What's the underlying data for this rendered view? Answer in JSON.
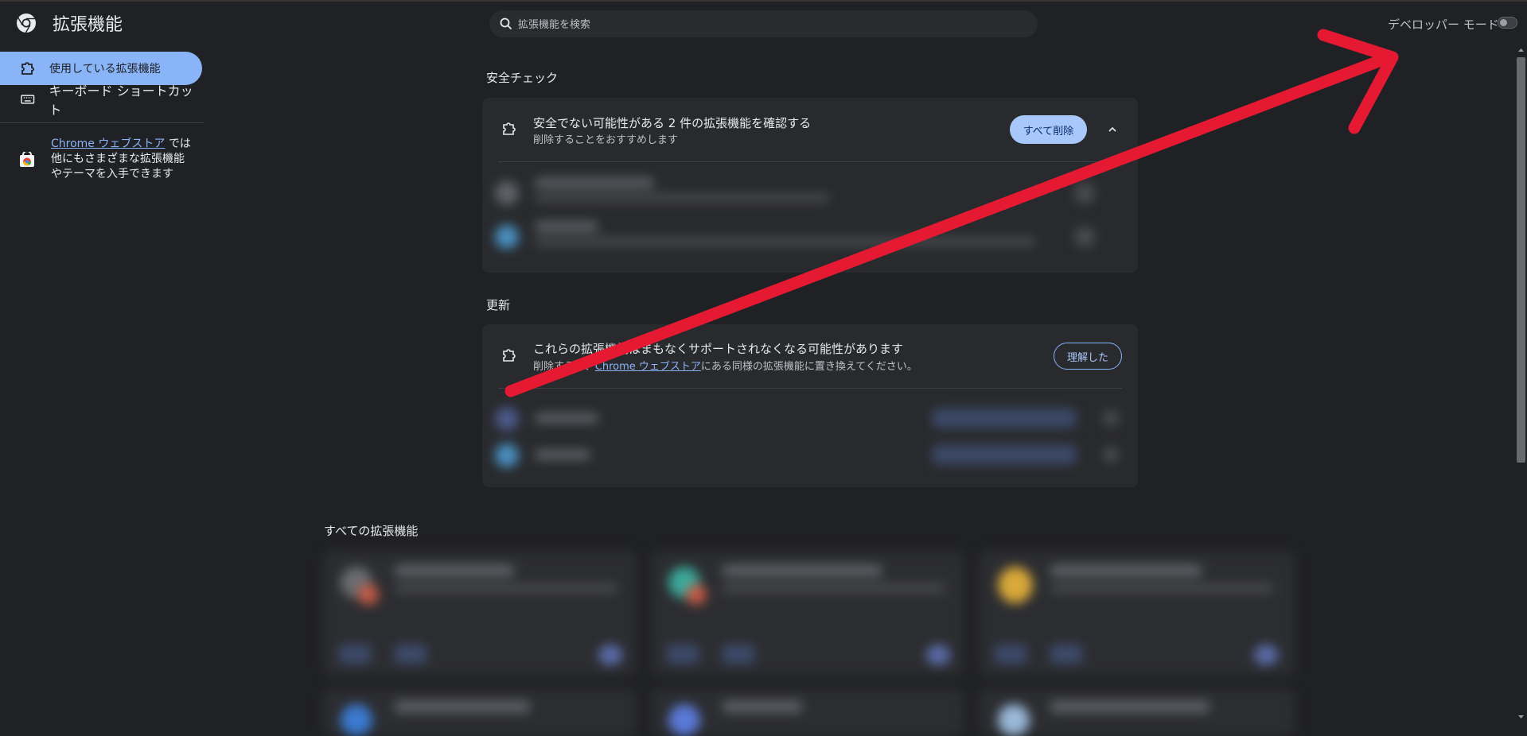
{
  "app": {
    "title": "拡張機能"
  },
  "search": {
    "placeholder": "拡張機能を検索"
  },
  "header": {
    "dev_mode_label": "デベロッパー モード",
    "dev_mode_on": false
  },
  "sidebar": {
    "items": [
      {
        "label": "使用している拡張機能",
        "icon": "puzzle-icon",
        "active": true
      },
      {
        "label": "キーボード ショートカット",
        "icon": "keyboard-icon",
        "active": false
      }
    ],
    "store": {
      "link_text": "Chrome ウェブストア",
      "text_after_link": " では",
      "line2": "他にもさまざまな拡張機能",
      "line3": "やテーマを入手できます"
    }
  },
  "safety": {
    "section_title": "安全チェック",
    "card_title": "安全でない可能性がある 2 件の拡張機能を確認する",
    "card_sub": "削除することをおすすめします",
    "button": "すべて削除"
  },
  "updates": {
    "section_title": "更新",
    "card_title": "これらの拡張機能はまもなくサポートされなくなる可能性があります",
    "sub_prefix": "削除するか、",
    "sub_link": "Chrome ウェブストア",
    "sub_suffix": "にある同様の拡張機能に置き換えてください。",
    "button": "理解した"
  },
  "all_extensions": {
    "section_title": "すべての拡張機能"
  },
  "colors": {
    "background": "#202124",
    "accent": "#8ab4f8",
    "annotation_arrow": "#e51a32"
  }
}
